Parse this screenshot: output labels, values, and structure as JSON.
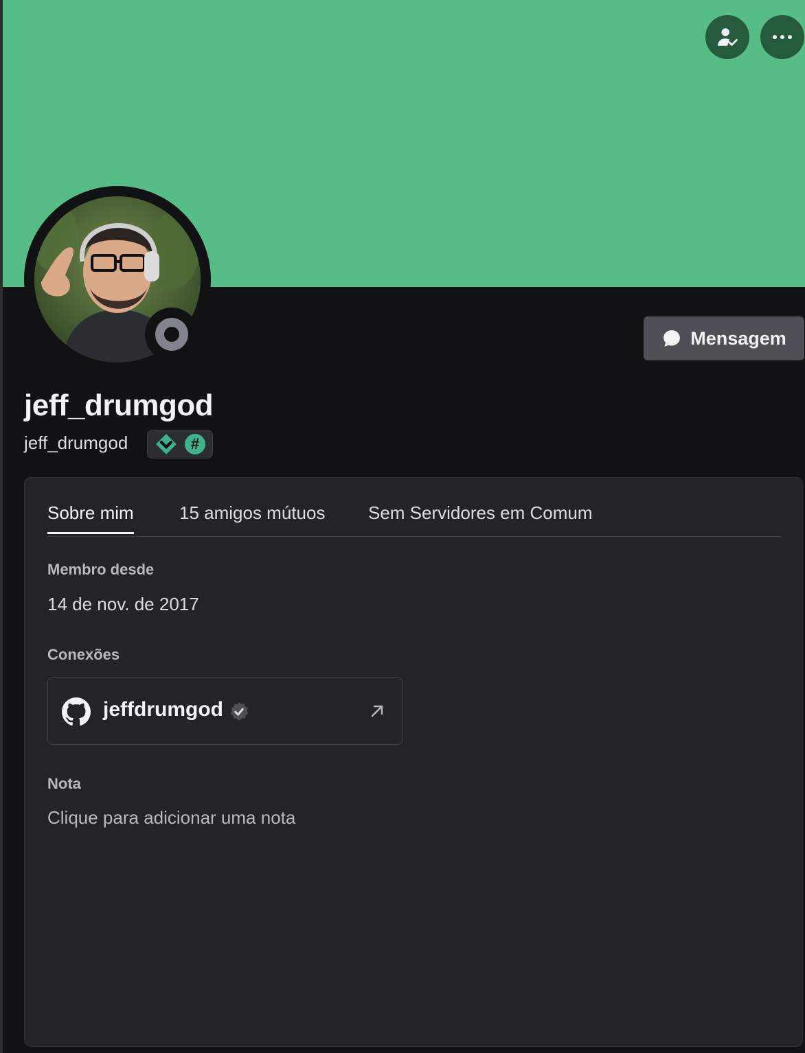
{
  "profile": {
    "display_name": "jeff_drumgod",
    "username": "jeff_drumgod",
    "status": "offline",
    "avatar_description": "user-avatar-photo"
  },
  "header": {
    "friend_button_icon": "person-check-icon",
    "more_button_icon": "more-horizontal-icon"
  },
  "message_button": {
    "label": "Mensagem",
    "icon": "chat-bubble-icon"
  },
  "badges": [
    "hypesquad-badge-icon",
    "hash-badge-icon"
  ],
  "badge_hash_text": "#",
  "tabs": [
    {
      "label": "Sobre mim",
      "active": true
    },
    {
      "label": "15 amigos mútuos",
      "active": false
    },
    {
      "label": "Sem Servidores em Comum",
      "active": false
    }
  ],
  "member_since": {
    "label": "Membro desde",
    "value": "14 de nov. de 2017"
  },
  "connections": {
    "label": "Conexões",
    "items": [
      {
        "service": "github-icon",
        "name": "jeffdrumgod",
        "verified": true
      }
    ]
  },
  "note": {
    "label": "Nota",
    "placeholder": "Clique para adicionar uma nota"
  },
  "colors": {
    "banner": "#56bd86",
    "banner_button": "#265a3d",
    "background": "#111214",
    "card": "#232428",
    "message_button": "#4e5058"
  }
}
